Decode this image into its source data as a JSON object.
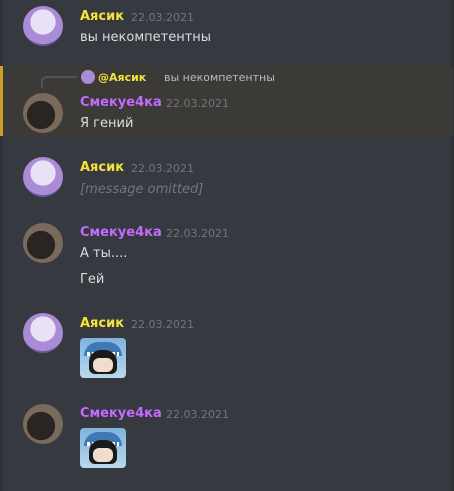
{
  "messages": [
    {
      "author": "Аясик",
      "time": "22.03.2021",
      "lines": [
        "вы некомпетентны"
      ]
    },
    {
      "author": "Смекуе4ка",
      "time": "22.03.2021",
      "lines": [
        "Я гений"
      ],
      "reply": {
        "author": "@Аясик",
        "text": "вы некомпетентны"
      }
    },
    {
      "author": "Аясик",
      "time": "22.03.2021",
      "lines": [
        "[message omitted]"
      ]
    },
    {
      "author": "Смекуе4ка",
      "time": "22.03.2021",
      "lines": [
        "А ты....",
        "Гей"
      ]
    },
    {
      "author": "Аясик",
      "time": "22.03.2021",
      "emoji": "shark-hood-emoji"
    },
    {
      "author": "Смекуе4ка",
      "time": "22.03.2021",
      "emoji": "shark-hood-emoji"
    }
  ],
  "colors": {
    "background": "#36393f",
    "ayasik": "#f5e33a",
    "smekue4ka": "#c36bff",
    "timestamp": "#72767d",
    "mention_highlight": "#c9a227"
  }
}
